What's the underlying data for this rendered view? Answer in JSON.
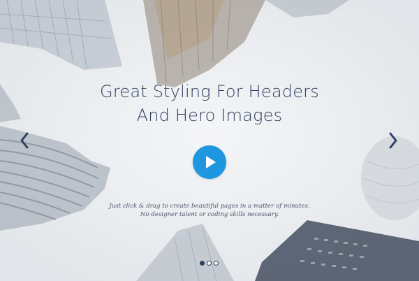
{
  "hero": {
    "headline_line1": "Great Styling For Headers",
    "headline_line2": "And Hero Images",
    "subtitle_line1": "Just click & drag to create beautiful pages in a matter of minutes.",
    "subtitle_line2": "No designer talent or coding skills necessary."
  },
  "controls": {
    "prev_icon": "chevron-left-icon",
    "next_icon": "chevron-right-icon",
    "play_icon": "play-icon"
  },
  "slider": {
    "total_slides": 3,
    "active_slide": 1
  },
  "colors": {
    "heading": "#2f3f60",
    "accent": "#1f97e0",
    "background": "#eef0f3"
  }
}
